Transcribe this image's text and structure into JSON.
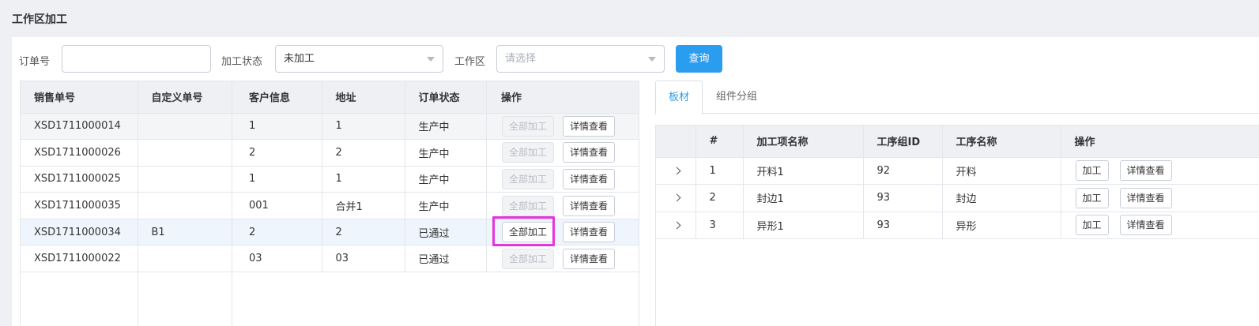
{
  "page": {
    "title": "工作区加工"
  },
  "filters": {
    "order_no_label": "订单号",
    "order_no_value": "",
    "status_label": "加工状态",
    "status_value": "未加工",
    "workspace_label": "工作区",
    "workspace_placeholder": "请选择",
    "query_button": "查询"
  },
  "orders": {
    "columns": [
      "销售单号",
      "自定义单号",
      "客户信息",
      "地址",
      "订单状态",
      "操作"
    ],
    "action_process_all": "全部加工",
    "action_view_details": "详情查看",
    "rows": [
      {
        "sale_no": "XSD1711000014",
        "custom_no": "",
        "customer": "1",
        "address": "1",
        "status": "生产中",
        "process_enabled": false
      },
      {
        "sale_no": "XSD1711000026",
        "custom_no": "",
        "customer": "2",
        "address": "2",
        "status": "生产中",
        "process_enabled": false
      },
      {
        "sale_no": "XSD1711000025",
        "custom_no": "",
        "customer": "1",
        "address": "1",
        "status": "生产中",
        "process_enabled": false
      },
      {
        "sale_no": "XSD1711000035",
        "custom_no": "",
        "customer": "001",
        "address": "合并1",
        "status": "生产中",
        "process_enabled": false
      },
      {
        "sale_no": "XSD1711000034",
        "custom_no": "B1",
        "customer": "2",
        "address": "2",
        "status": "已通过",
        "process_enabled": true
      },
      {
        "sale_no": "XSD1711000022",
        "custom_no": "",
        "customer": "03",
        "address": "03",
        "status": "已通过",
        "process_enabled": false
      }
    ]
  },
  "detail": {
    "tabs": [
      {
        "label": "板材",
        "active": true
      },
      {
        "label": "组件分组",
        "active": false
      }
    ],
    "columns": [
      "",
      "#",
      "加工项名称",
      "工序组ID",
      "工序名称",
      "操作"
    ],
    "action_process": "加工",
    "action_view_details": "详情查看",
    "rows": [
      {
        "index": "1",
        "item_name": "开料1",
        "group_id": "92",
        "process_name": "开料"
      },
      {
        "index": "2",
        "item_name": "封边1",
        "group_id": "93",
        "process_name": "封边"
      },
      {
        "index": "3",
        "item_name": "异形1",
        "group_id": "93",
        "process_name": "异形"
      }
    ]
  },
  "colors": {
    "accent": "#2b9df0",
    "highlight_row": "#eef5fc",
    "focus_outline": "#e633e0"
  }
}
